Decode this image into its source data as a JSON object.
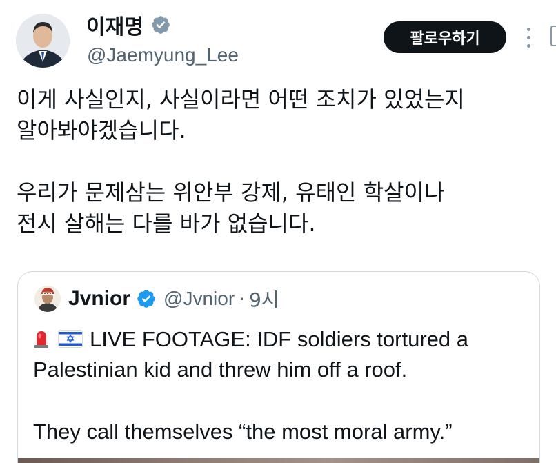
{
  "header": {
    "display_name": "이재명",
    "handle": "@Jaemyung_Lee",
    "follow_label": "팔로우하기"
  },
  "tweet": {
    "lines": [
      "이게 사실인지, 사실이라면 어떤 조치가 있었는지",
      "알아봐야겠습니다.",
      "우리가 문제삼는 위안부 강제, 유태인 학살이나",
      "전시 살해는 다를 바가 없습니다."
    ]
  },
  "quote": {
    "name": "Jvnior",
    "handle": "@Jvnior",
    "separator": "·",
    "time": "9시",
    "line1": "LIVE FOOTAGE: IDF soldiers tortured a",
    "line2": "Palestinian kid and threw him off a roof.",
    "line3": "They call themselves “the most moral army.”",
    "emojis": [
      "police-siren-icon",
      "israel-flag-icon"
    ]
  },
  "colors": {
    "text": "#0f1419",
    "secondary": "#536471",
    "verified_gray": "#829aab",
    "verified_blue": "#1d9bf0",
    "border": "#cfd9de",
    "button_bg": "#0f1419"
  }
}
